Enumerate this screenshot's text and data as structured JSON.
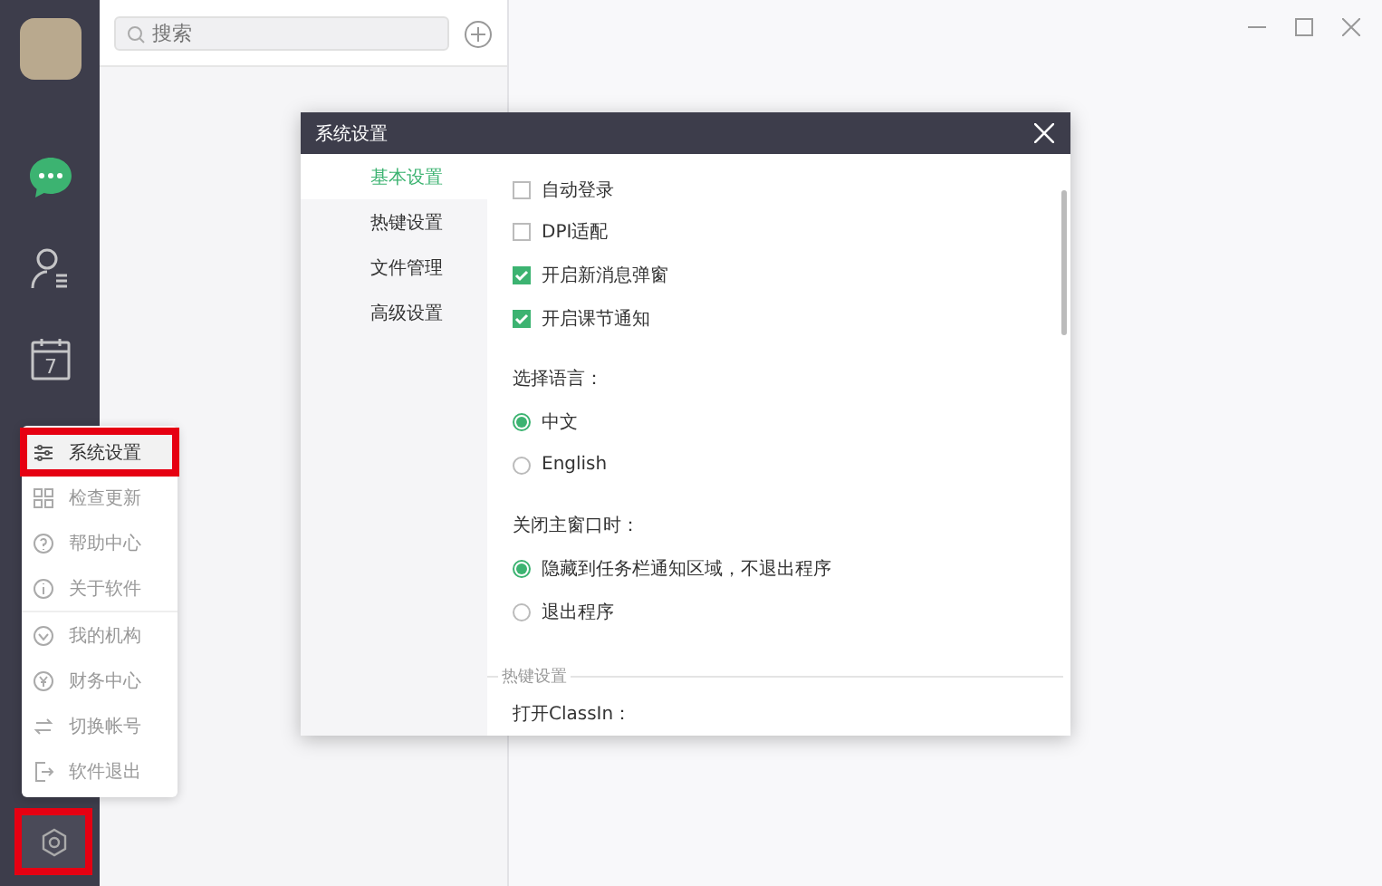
{
  "search": {
    "placeholder": "搜索"
  },
  "sidebar": {
    "items": [
      {
        "kind": "chat",
        "selected": true
      },
      {
        "kind": "contacts",
        "selected": false
      },
      {
        "kind": "calendar",
        "selected": false,
        "label": "7"
      }
    ],
    "settings_button": {
      "highlighted": true
    }
  },
  "menu": {
    "items": [
      {
        "kind": "sliders",
        "label": "系统设置",
        "highlighted": true,
        "divider_after": false
      },
      {
        "kind": "grid",
        "label": "检查更新",
        "highlighted": false,
        "divider_after": false
      },
      {
        "kind": "help",
        "label": "帮助中心",
        "highlighted": false,
        "divider_after": false
      },
      {
        "kind": "info",
        "label": "关于软件",
        "highlighted": false,
        "divider_after": true
      },
      {
        "kind": "org",
        "label": "我的机构",
        "highlighted": false,
        "divider_after": false
      },
      {
        "kind": "yen",
        "label": "财务中心",
        "highlighted": false,
        "divider_after": false
      },
      {
        "kind": "swap",
        "label": "切换帐号",
        "highlighted": false,
        "divider_after": false
      },
      {
        "kind": "exit",
        "label": "软件退出",
        "highlighted": false,
        "divider_after": false
      }
    ]
  },
  "dialog": {
    "title": "系统设置",
    "nav": [
      {
        "label": "基本设置",
        "selected": true
      },
      {
        "label": "热键设置",
        "selected": false
      },
      {
        "label": "文件管理",
        "selected": false
      },
      {
        "label": "高级设置",
        "selected": false
      }
    ],
    "content": [
      {
        "kind": "checkbox",
        "label": "自动登录",
        "checked": false
      },
      {
        "kind": "checkbox",
        "label": "DPI适配",
        "checked": false
      },
      {
        "kind": "checkbox",
        "label": "开启新消息弹窗",
        "checked": true
      },
      {
        "kind": "checkbox",
        "label": "开启课节通知",
        "checked": true
      },
      {
        "kind": "heading",
        "label": "选择语言："
      },
      {
        "kind": "radio",
        "label": "中文",
        "selected": true
      },
      {
        "kind": "radio",
        "label": "English",
        "selected": false
      },
      {
        "kind": "heading",
        "label": "关闭主窗口时："
      },
      {
        "kind": "radio",
        "label": "隐藏到任务栏通知区域，不退出程序",
        "selected": true
      },
      {
        "kind": "radio",
        "label": "退出程序",
        "selected": false
      },
      {
        "kind": "section",
        "label": "热键设置"
      },
      {
        "kind": "heading",
        "label": "打开ClassIn："
      }
    ]
  }
}
